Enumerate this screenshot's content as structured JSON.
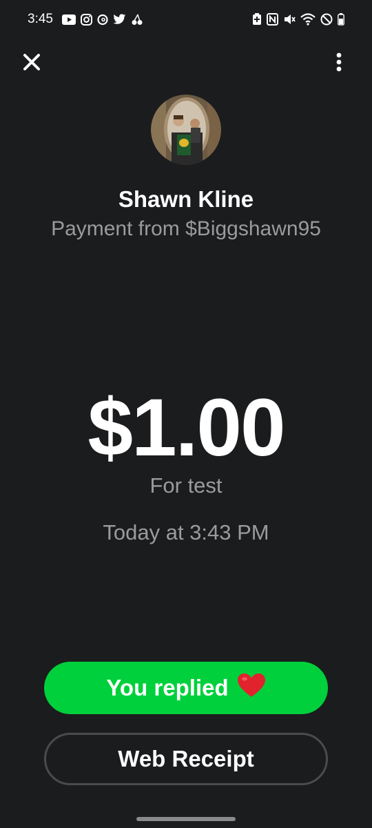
{
  "status_bar": {
    "time": "3:45",
    "left_icons": [
      "youtube-icon",
      "instagram-icon",
      "threads-icon",
      "twitter-icon",
      "cherries-icon"
    ],
    "right_icons": [
      "battery-saver-icon",
      "nfc-icon",
      "mute-icon",
      "wifi-icon",
      "do-not-disturb-icon",
      "battery-icon"
    ]
  },
  "header": {
    "close_icon": "close-icon",
    "menu_icon": "more-vertical-icon"
  },
  "payment": {
    "name": "Shawn Kline",
    "subtitle": "Payment from $Biggshawn95",
    "amount": "$1.00",
    "note": "For test",
    "timestamp": "Today at 3:43 PM"
  },
  "actions": {
    "replied_label": "You replied",
    "replied_emoji": "heart-icon",
    "receipt_label": "Web Receipt"
  },
  "colors": {
    "background": "#1b1c1e",
    "accent_green": "#00d03b",
    "muted_text": "#9a9b9d",
    "heart_red": "#e0232d"
  }
}
